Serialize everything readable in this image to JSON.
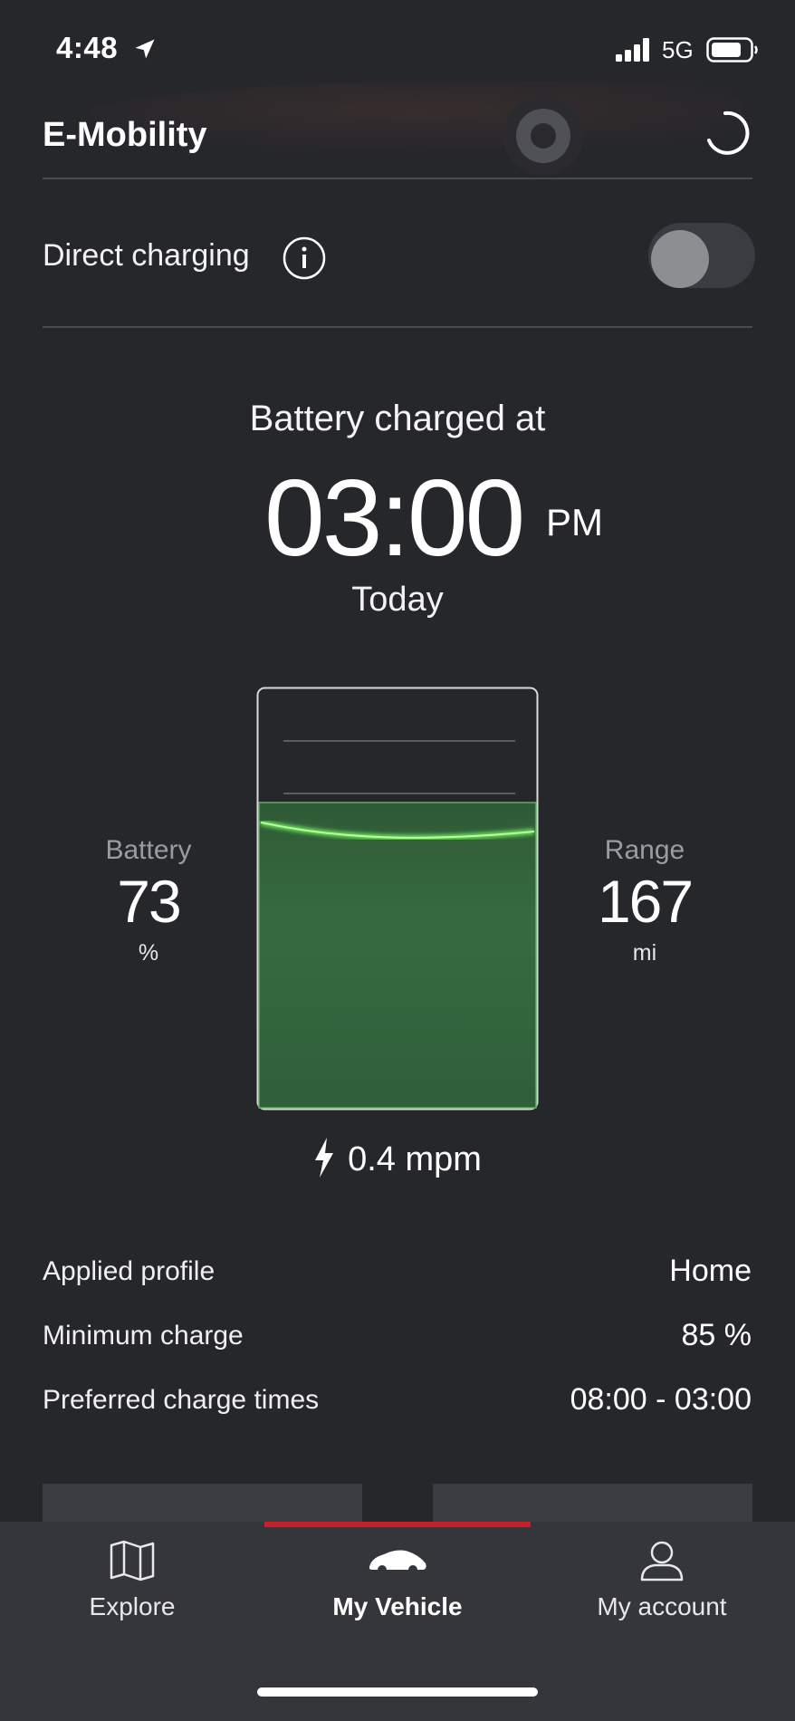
{
  "status_bar": {
    "time": "4:48",
    "network": "5G",
    "icons": [
      "location-arrow-icon",
      "signal-bars-icon",
      "battery-icon"
    ]
  },
  "header": {
    "title": "E-Mobility",
    "icons": [
      "loading-spinner-icon"
    ]
  },
  "direct_charging": {
    "label": "Direct charging",
    "enabled": false,
    "icons": [
      "info-icon"
    ]
  },
  "charge_status": {
    "heading": "Battery charged at",
    "time": "03:00",
    "ampm": "PM",
    "day": "Today"
  },
  "battery": {
    "label": "Battery",
    "value": "73",
    "unit": "%",
    "level": 0.73
  },
  "range": {
    "label": "Range",
    "value": "167",
    "unit": "mi"
  },
  "charging_rate": {
    "value": "0.4 mpm",
    "icon": "lightning-bolt-icon"
  },
  "details": [
    {
      "label": "Applied profile",
      "value": "Home"
    },
    {
      "label": "Minimum charge",
      "value": "85 %"
    },
    {
      "label": "Preferred charge times",
      "value": "08:00 - 03:00"
    }
  ],
  "nav": {
    "active": "My Vehicle",
    "items": [
      {
        "label": "Explore",
        "icon": "map-icon"
      },
      {
        "label": "My Vehicle",
        "icon": "car-icon"
      },
      {
        "label": "My account",
        "icon": "user-icon"
      }
    ]
  },
  "colors": {
    "background": "#26272b",
    "charge_green": "#6de85a",
    "accent_red": "#c8202a"
  }
}
